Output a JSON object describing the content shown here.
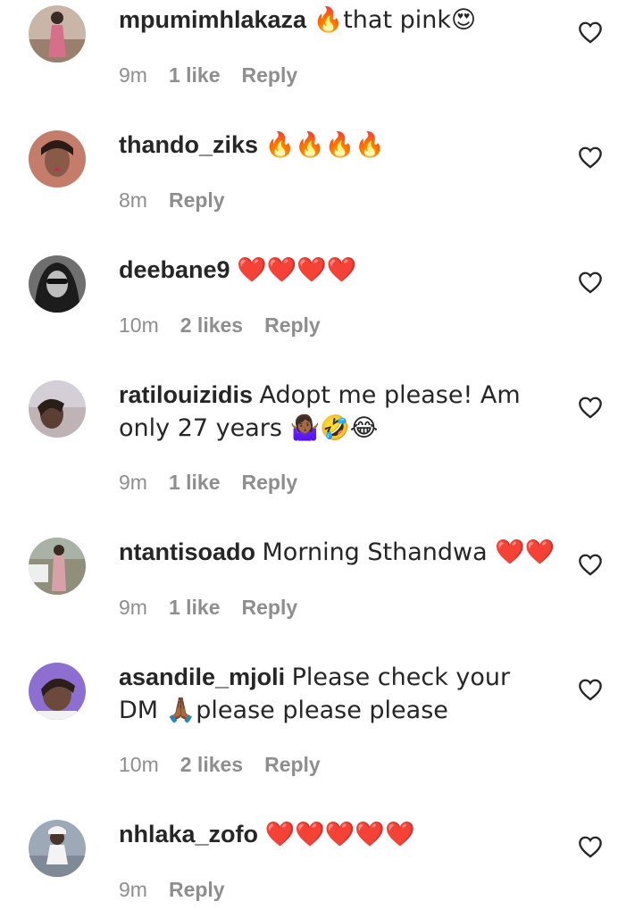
{
  "comments": [
    {
      "username": "mpumimhlakaza",
      "text": "🔥that pink😍",
      "time": "9m",
      "likes": "1 like",
      "reply": "Reply",
      "avatar_bg": "#c9b6a8",
      "avatar_fg": "#a85466"
    },
    {
      "username": "thando_ziks",
      "text": "🔥🔥🔥🔥",
      "time": "8m",
      "likes": "",
      "reply": "Reply",
      "avatar_bg": "#c47d6a",
      "avatar_fg": "#2a1b16"
    },
    {
      "username": "deebane9",
      "text": "❤️❤️❤️❤️",
      "time": "10m",
      "likes": "2 likes",
      "reply": "Reply",
      "avatar_bg": "#6f6f6f",
      "avatar_fg": "#1c1c1c"
    },
    {
      "username": "ratilouizidis",
      "text": "Adopt me please! Am only 27 years 🤷🏾‍♀️🤣😂",
      "time": "9m",
      "likes": "1 like",
      "reply": "Reply",
      "avatar_bg": "#bfb3b6",
      "avatar_fg": "#3d2b27"
    },
    {
      "username": "ntantisoado",
      "text": "Morning Sthandwa ❤️❤️",
      "time": "9m",
      "likes": "1 like",
      "reply": "Reply",
      "avatar_bg": "#8f8f7c",
      "avatar_fg": "#d8a0a8"
    },
    {
      "username": "asandile_mjoli",
      "text": "Please check your DM 🙏🏾please please please",
      "time": "10m",
      "likes": "2 likes",
      "reply": "Reply",
      "avatar_bg": "#8d6fd1",
      "avatar_fg": "#2d1e19"
    },
    {
      "username": "nhlaka_zofo",
      "text": "❤️❤️❤️❤️❤️",
      "time": "9m",
      "likes": "",
      "reply": "Reply",
      "avatar_bg": "#9ea9b7",
      "avatar_fg": "#f3f3f3"
    }
  ],
  "icons": {
    "like": "heart-outline-icon"
  },
  "colors": {
    "text": "#262626",
    "meta": "#8e8e8e"
  }
}
